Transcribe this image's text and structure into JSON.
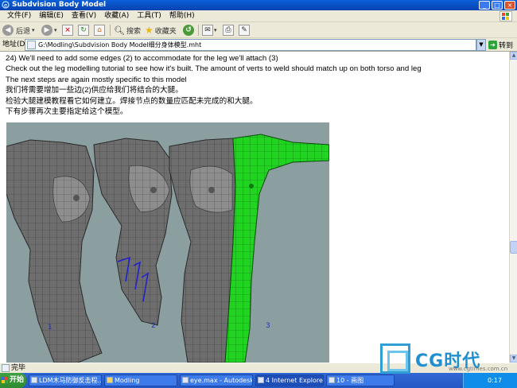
{
  "window": {
    "title": "Subdvision Body Model",
    "buttons": [
      "_",
      "□",
      "×"
    ]
  },
  "menu": [
    "文件(F)",
    "编辑(E)",
    "查看(V)",
    "收藏(A)",
    "工具(T)",
    "帮助(H)"
  ],
  "toolbar": {
    "back": "后退",
    "search": "搜索",
    "favorites": "收藏夹"
  },
  "address": {
    "label": "地址(D)",
    "value": "G:\\Modling\\Subdvision Body Model细分身体模型.mht",
    "go": "转到"
  },
  "content": {
    "lines": [
      "24) We'll need to add some edges (2) to accommodate for the leg we'll attach (3)",
      "Check out the leg modelling tutorial to see how it's built. The amount of verts to weld should match up on both torso and leg",
      "The next steps are again mostly specific to this model",
      "我们将需要增加一些边(2)供应给我们将结合的大腿。",
      "检验大腿建模教程看它如何建立。焊接节点的数量应匹配未完成的和大腿。",
      "下有步骤再次主要指定给这个模型。"
    ],
    "figure_labels": [
      "1",
      "2",
      "3"
    ]
  },
  "status": {
    "text": "完毕"
  },
  "taskbar": {
    "start": "开始",
    "tasks": [
      "LDM木马防御反击程...",
      "Modling",
      "eye.max - Autodesk 3...",
      "4 Internet Explorer",
      "10 - 画图"
    ],
    "clock": "0:17"
  },
  "watermark": {
    "brand": "CG时代",
    "url": "www.cgtimes.com.cn"
  },
  "colors": {
    "titlebar": "#0a5fd8",
    "accent_green": "#22d422",
    "mesh_gray": "#6e6e6e",
    "background": "#8b9ea0"
  }
}
